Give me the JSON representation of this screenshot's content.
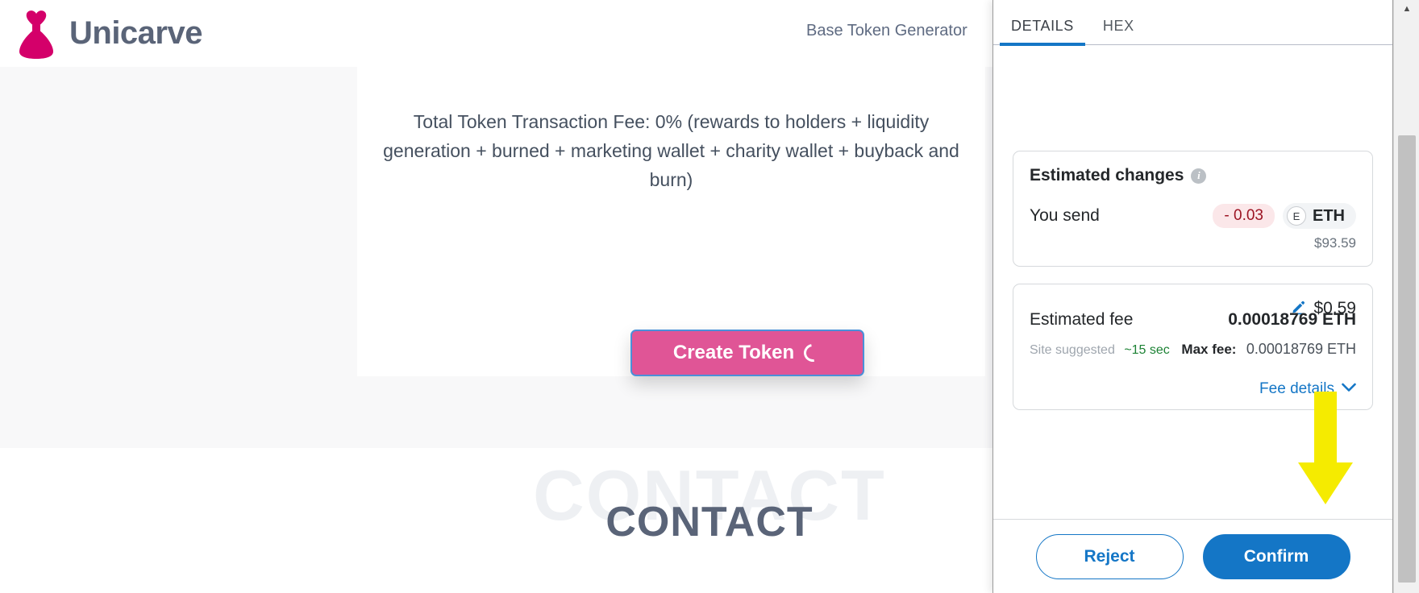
{
  "site": {
    "brand": "Unicarve",
    "logo_icon": "heart-dress-logo-icon",
    "nav_link": "Base Token Generator",
    "fee_copy": "Total Token Transaction Fee: 0% (rewards to holders + liquidity generation + burned + marketing wallet + charity wallet + buyback and burn)",
    "create_token_button": "Create Token",
    "create_token_spinner_icon": "loading-spinner-icon",
    "contact_ghost": "CONTACT",
    "contact_title": "CONTACT",
    "accent_pink": "#e05596",
    "brand_text_color": "#5a6478"
  },
  "wallet": {
    "tabs": [
      {
        "label": "DETAILS",
        "active": true
      },
      {
        "label": "HEX",
        "active": false
      }
    ],
    "estimated_changes": {
      "title": "Estimated changes",
      "info_icon": "info-icon",
      "info_glyph": "i",
      "row_label": "You send",
      "amount": "- 0.03",
      "token_avatar_letter": "E",
      "token_symbol": "ETH",
      "fiat_value": "$93.59",
      "amount_color": "#9c1423",
      "amount_bg": "#fbe7e9"
    },
    "estimated_fee": {
      "label": "Estimated fee",
      "edit_icon": "pencil-edit-icon",
      "fiat": "$0.59",
      "eth_amount": "0.00018769 ETH",
      "site_suggested": "Site suggested",
      "eta": "~15 sec",
      "max_fee_label": "Max fee:",
      "max_fee_value": "0.00018769 ETH",
      "eta_color": "#1c8234"
    },
    "fee_details": {
      "label": "Fee details",
      "chevron_icon": "chevron-down-icon",
      "chevron_glyph": "⌄"
    },
    "footer": {
      "reject_label": "Reject",
      "confirm_label": "Confirm",
      "primary_color": "#1476c6"
    }
  },
  "annotation": {
    "arrow_icon": "yellow-down-arrow-icon",
    "arrow_color": "#f5eb00"
  },
  "scrollbar": {
    "up_arrow_icon": "scroll-up-arrow-icon",
    "up_arrow_glyph": "▲"
  }
}
